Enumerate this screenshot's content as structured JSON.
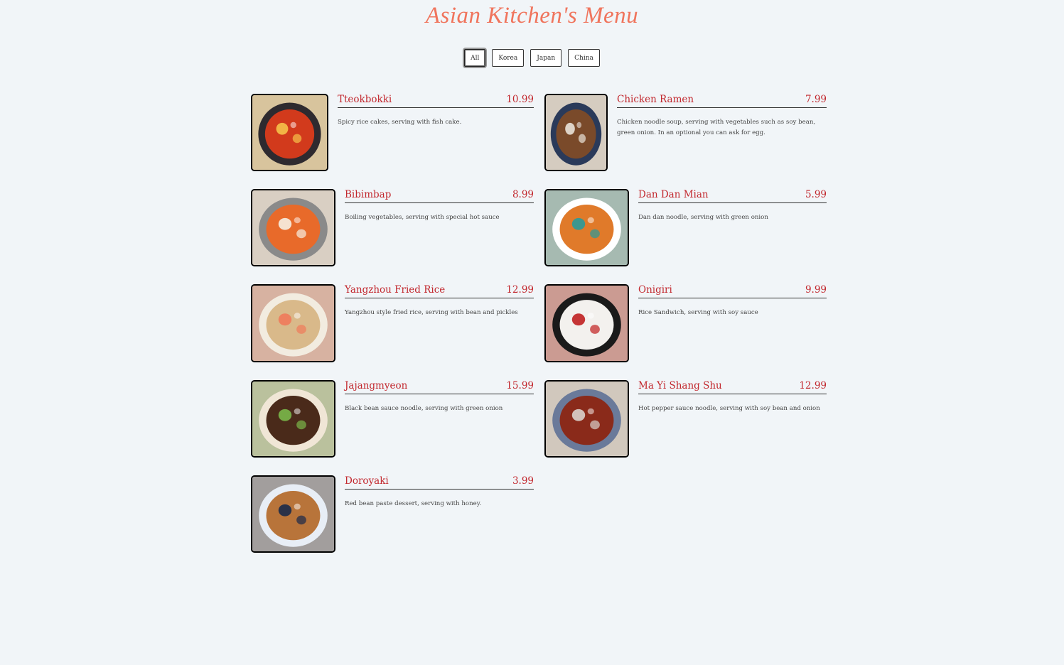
{
  "page": {
    "title": "Asian Kitchen's Menu"
  },
  "filters": [
    {
      "label": "All",
      "active": true
    },
    {
      "label": "Korea",
      "active": false
    },
    {
      "label": "Japan",
      "active": false
    },
    {
      "label": "China",
      "active": false
    }
  ],
  "items": [
    {
      "name": "Tteokbokki",
      "price": "10.99",
      "desc": "Spicy rice cakes, serving with fish cake.",
      "dish_icon": "tteokbokki-photo",
      "colors": {
        "plate": "#2e2a2f",
        "food": "#d23a1c",
        "accent": "#f5c24a"
      }
    },
    {
      "name": "Chicken Ramen",
      "price": "7.99",
      "desc": "Chicken noodle soup, serving with vegetables such as soy bean, green onion. In an optional you can ask for egg.",
      "dish_icon": "ramen-photo",
      "colors": {
        "plate": "#2a3a5a",
        "food": "#7a4a2a",
        "accent": "#e9e2d8"
      }
    },
    {
      "name": "Bibimbap",
      "price": "8.99",
      "desc": "Boiling vegetables, serving with special hot sauce",
      "dish_icon": "bibimbap-photo",
      "colors": {
        "plate": "#8a8a8a",
        "food": "#e86a2a",
        "accent": "#f6f0e2"
      }
    },
    {
      "name": "Dan Dan Mian",
      "price": "5.99",
      "desc": "Dan dan noodle, serving with green onion",
      "dish_icon": "dandanmian-photo",
      "colors": {
        "plate": "#ffffff",
        "food": "#e07a2a",
        "accent": "#2a9a9a"
      }
    },
    {
      "name": "Yangzhou Fried Rice",
      "price": "12.99",
      "desc": "Yangzhou style fried rice, serving with bean and pickles",
      "dish_icon": "fried-rice-photo",
      "colors": {
        "plate": "#f2ece0",
        "food": "#d9b98a",
        "accent": "#f07a5a"
      }
    },
    {
      "name": "Onigiri",
      "price": "9.99",
      "desc": "Rice Sandwich, serving with soy sauce",
      "dish_icon": "onigiri-photo",
      "colors": {
        "plate": "#1a1a1a",
        "food": "#f3f1ee",
        "accent": "#c02020"
      }
    },
    {
      "name": "Jajangmyeon",
      "price": "15.99",
      "desc": "Black bean sauce noodle, serving with green onion",
      "dish_icon": "jajangmyeon-photo",
      "colors": {
        "plate": "#f0e6d6",
        "food": "#4a2a1a",
        "accent": "#7ab84a"
      }
    },
    {
      "name": "Ma Yi Shang Shu",
      "price": "12.99",
      "desc": "Hot pepper sauce noodle, serving with soy bean and onion",
      "dish_icon": "mayishangshu-photo",
      "colors": {
        "plate": "#6a7a9a",
        "food": "#8a2a1a",
        "accent": "#d9d2cc"
      }
    },
    {
      "name": "Doroyaki",
      "price": "3.99",
      "desc": "Red bean paste dessert, serving with honey.",
      "dish_icon": "dorayaki-photo",
      "colors": {
        "plate": "#e8eef6",
        "food": "#b8743a",
        "accent": "#1a2a4a"
      }
    }
  ]
}
